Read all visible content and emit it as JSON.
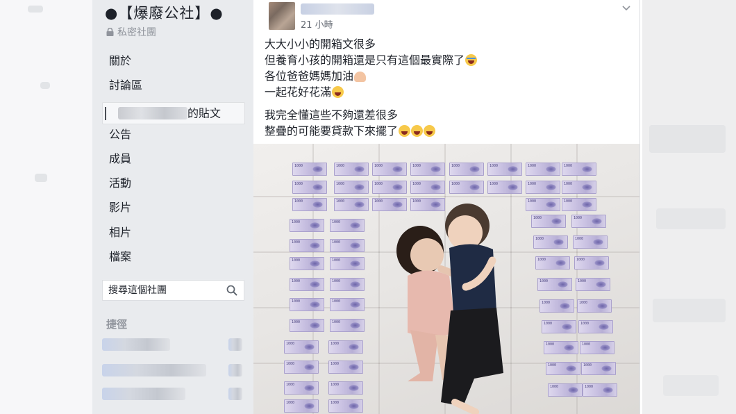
{
  "group": {
    "title": "●【爆廢公社】●",
    "privacy_label": "私密社團"
  },
  "nav": {
    "items": [
      {
        "label": "關於"
      },
      {
        "label": "討論區"
      },
      {
        "label": "的貼文",
        "active": true
      },
      {
        "label": "公告"
      },
      {
        "label": "成員"
      },
      {
        "label": "活動"
      },
      {
        "label": "影片"
      },
      {
        "label": "相片"
      },
      {
        "label": "檔案"
      }
    ]
  },
  "search": {
    "placeholder": "搜尋這個社團"
  },
  "shortcuts": {
    "heading": "捷徑"
  },
  "post": {
    "timestamp": "21 小時",
    "lines": [
      "大大小小的開箱文很多",
      "但養育小孩的開箱還是只有這個最實際了",
      "各位爸爸媽媽加油",
      "一起花好花滿",
      "我完全懂這些不夠還差很多",
      "整疊的可能要貸款下來擺了"
    ],
    "photo_banknote_denomination": "1000"
  },
  "icons": {
    "lock": "lock-icon",
    "search": "search-icon",
    "menu": "chevron-down-icon"
  },
  "colors": {
    "sidebar_bg": "#e9ebee",
    "text": "#1d2129",
    "muted": "#90949c"
  }
}
